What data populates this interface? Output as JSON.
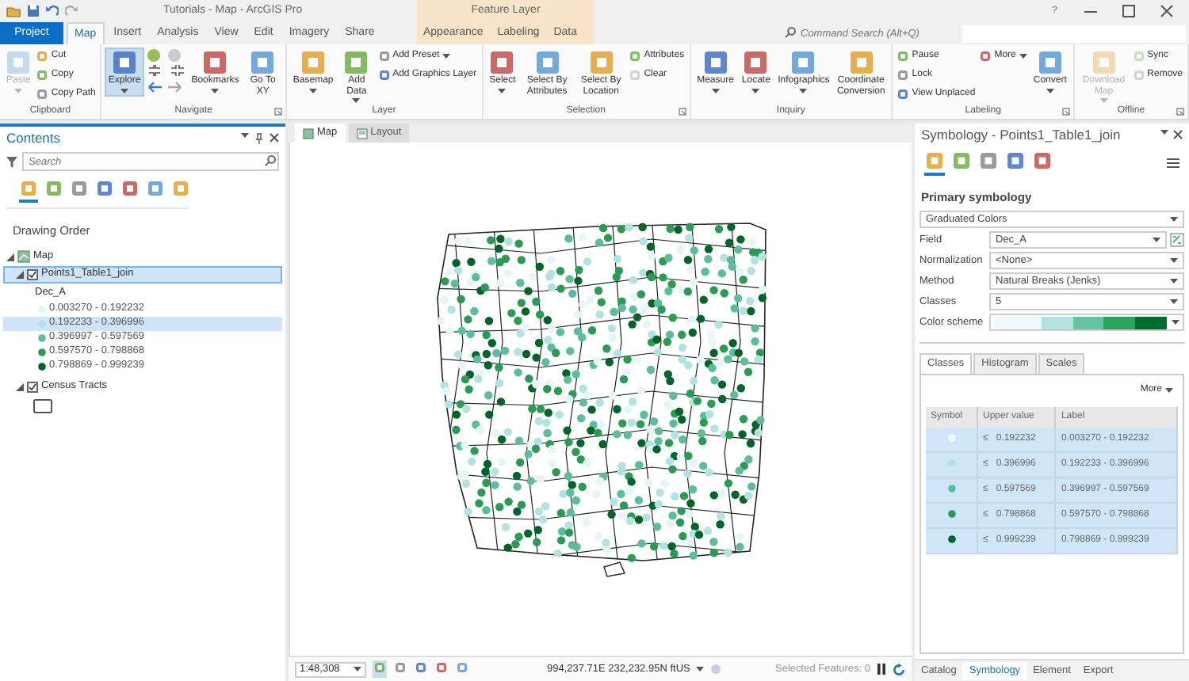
{
  "title_bar": {
    "title": "Tutorials - Map - ArcGIS Pro",
    "context_header": "Feature Layer",
    "help": "?"
  },
  "ribbon_tabs": [
    {
      "label": "Project",
      "kind": "backstage",
      "selected": false
    },
    {
      "label": "Map",
      "kind": "core",
      "selected": true
    },
    {
      "label": "Insert",
      "kind": "core",
      "selected": false
    },
    {
      "label": "Analysis",
      "kind": "core",
      "selected": false
    },
    {
      "label": "View",
      "kind": "core",
      "selected": false
    },
    {
      "label": "Edit",
      "kind": "core",
      "selected": false
    },
    {
      "label": "Imagery",
      "kind": "core",
      "selected": false
    },
    {
      "label": "Share",
      "kind": "core",
      "selected": false
    },
    {
      "label": "Appearance",
      "kind": "contextual",
      "selected": false
    },
    {
      "label": "Labeling",
      "kind": "contextual",
      "selected": false
    },
    {
      "label": "Data",
      "kind": "contextual",
      "selected": false
    }
  ],
  "command_search": {
    "placeholder": "Command Search (Alt+Q)"
  },
  "ribbon_groups": [
    {
      "label": "Clipboard",
      "launcher": false,
      "commands": [
        {
          "label": "Paste",
          "kind": "large",
          "menu": true,
          "disabled": true,
          "selected": false
        },
        {
          "label": "Cut",
          "kind": "small",
          "menu": false,
          "disabled": false,
          "selected": false
        },
        {
          "label": "Copy",
          "kind": "small",
          "menu": false,
          "disabled": false,
          "selected": false
        },
        {
          "label": "Copy Path",
          "kind": "small",
          "menu": false,
          "disabled": false,
          "selected": false
        }
      ]
    },
    {
      "label": "Navigate",
      "launcher": true,
      "commands": [
        {
          "label": "Explore",
          "kind": "large",
          "menu": true,
          "disabled": false,
          "selected": true
        },
        {
          "kind": "nav_grid",
          "menu": false,
          "disabled": false,
          "selected": false
        },
        {
          "label": "Bookmarks",
          "kind": "large",
          "menu": true,
          "disabled": false,
          "selected": false
        },
        {
          "label": "Go To XY",
          "kind": "large",
          "menu": false,
          "disabled": false,
          "selected": false
        }
      ]
    },
    {
      "label": "Layer",
      "launcher": false,
      "commands": [
        {
          "label": "Basemap",
          "kind": "large",
          "menu": true,
          "disabled": false,
          "selected": false
        },
        {
          "label": "Add Data",
          "kind": "large",
          "menu": true,
          "disabled": false,
          "selected": false
        },
        {
          "label": "Add Preset",
          "kind": "small",
          "menu": true,
          "disabled": false,
          "selected": false
        },
        {
          "label": "Add Graphics Layer",
          "kind": "small",
          "menu": false,
          "disabled": false,
          "selected": false
        }
      ]
    },
    {
      "label": "Selection",
      "launcher": true,
      "commands": [
        {
          "label": "Select",
          "kind": "large",
          "menu": true,
          "disabled": false,
          "selected": false
        },
        {
          "label": "Select By Attributes",
          "kind": "large",
          "menu": false,
          "disabled": false,
          "selected": false
        },
        {
          "label": "Select By Location",
          "kind": "large",
          "menu": false,
          "disabled": false,
          "selected": false
        },
        {
          "label": "Attributes",
          "kind": "small",
          "menu": false,
          "disabled": false,
          "selected": false
        },
        {
          "label": "Clear",
          "kind": "small",
          "menu": false,
          "disabled": true,
          "selected": false
        }
      ]
    },
    {
      "label": "Inquiry",
      "launcher": false,
      "commands": [
        {
          "label": "Measure",
          "kind": "large",
          "menu": true,
          "disabled": false,
          "selected": false
        },
        {
          "label": "Locate",
          "kind": "large",
          "menu": true,
          "disabled": false,
          "selected": false
        },
        {
          "label": "Infographics",
          "kind": "large",
          "menu": true,
          "disabled": false,
          "selected": false
        },
        {
          "label": "Coordinate Conversion",
          "kind": "large",
          "menu": false,
          "disabled": false,
          "selected": false
        }
      ]
    },
    {
      "label": "Labeling",
      "launcher": true,
      "commands": [
        {
          "label": "Pause",
          "kind": "small",
          "menu": false,
          "disabled": false,
          "selected": false
        },
        {
          "label": "Lock",
          "kind": "small",
          "menu": false,
          "disabled": false,
          "selected": false
        },
        {
          "label": "View Unplaced",
          "kind": "small",
          "menu": false,
          "disabled": false,
          "selected": false
        },
        {
          "label": "More",
          "kind": "small",
          "menu": true,
          "disabled": false,
          "selected": false
        },
        {
          "label": "Convert",
          "kind": "large",
          "menu": true,
          "disabled": false,
          "selected": false
        }
      ]
    },
    {
      "label": "Offline",
      "launcher": true,
      "commands": [
        {
          "label": "Download Map",
          "kind": "large",
          "menu": true,
          "disabled": true,
          "selected": false
        },
        {
          "label": "Sync",
          "kind": "small",
          "menu": false,
          "disabled": true,
          "selected": false
        },
        {
          "label": "Remove",
          "kind": "small",
          "menu": false,
          "disabled": true,
          "selected": false
        }
      ]
    }
  ],
  "contents": {
    "title": "Contents",
    "search": {
      "placeholder": "Search"
    },
    "view_tools": [
      {
        "selected": true
      },
      {
        "selected": false
      },
      {
        "selected": false
      },
      {
        "selected": false
      },
      {
        "selected": false
      },
      {
        "selected": false
      },
      {
        "selected": false
      }
    ],
    "heading": "Drawing Order",
    "tree": [
      {
        "label": "Map",
        "kind": "map",
        "expanded": true,
        "selected": false,
        "children": [
          {
            "label": "Points1_Table1_join",
            "kind": "points",
            "checked": true,
            "selected": true,
            "expanded": true,
            "legend_field": "Dec_A",
            "classes": [
              {
                "label": "0.003270 - 0.192232",
                "color": "#e6f5f5",
                "selected": false
              },
              {
                "label": "0.192233 - 0.396996",
                "color": "#b2e2e2",
                "selected": true
              },
              {
                "label": "0.396997 - 0.597569",
                "color": "#5cbc9b",
                "selected": false
              },
              {
                "label": "0.597570 - 0.798868",
                "color": "#2a9a55",
                "selected": false
              },
              {
                "label": "0.798869 - 0.999239",
                "color": "#00632a",
                "selected": false
              }
            ]
          },
          {
            "label": "Census Tracts",
            "kind": "polygons",
            "checked": true,
            "selected": false,
            "expanded": true
          }
        ]
      }
    ]
  },
  "map_view": {
    "tabs": [
      {
        "label": "Map",
        "kind": "map",
        "selected": true
      },
      {
        "label": "Layout",
        "kind": "layout",
        "selected": false
      }
    ],
    "scale": "1:48,308",
    "status_tools": [
      {
        "selected": true
      },
      {
        "selected": false
      },
      {
        "selected": false
      },
      {
        "selected": false
      },
      {
        "selected": false
      }
    ],
    "coordinates": "994,237.71E 232,232.95N ftUS",
    "selected_features": "Selected Features: 0"
  },
  "symbology": {
    "title": "Symbology - Points1_Table1_join",
    "tools": [
      {
        "selected": true
      },
      {
        "selected": false
      },
      {
        "selected": false
      },
      {
        "selected": false
      },
      {
        "selected": false
      }
    ],
    "section": "Primary symbology",
    "renderer": "Graduated Colors",
    "fields": [
      {
        "label": "Field",
        "kind": "expression",
        "value": "Dec_A"
      },
      {
        "label": "Normalization",
        "kind": "select",
        "value": "<None>"
      },
      {
        "label": "Method",
        "kind": "select",
        "value": "Natural Breaks (Jenks)"
      },
      {
        "label": "Classes",
        "kind": "select",
        "value": "5"
      },
      {
        "label": "Color scheme",
        "kind": "ramp",
        "ramp": [
          {
            "color": "#edf8fb"
          },
          {
            "color": "#b2e2e2"
          },
          {
            "color": "#66c2a4"
          },
          {
            "color": "#2ca25f"
          },
          {
            "color": "#006d2c"
          }
        ]
      }
    ],
    "tabs": [
      {
        "label": "Classes",
        "selected": true
      },
      {
        "label": "Histogram",
        "selected": false
      },
      {
        "label": "Scales",
        "selected": false
      }
    ],
    "more": "More",
    "columns": [
      "Symbol",
      "Upper value",
      "Label"
    ],
    "classes": [
      {
        "color": "#f4fbfb",
        "operator": "≤",
        "upper": "0.192232",
        "label": "0.003270 - 0.192232",
        "selected": true
      },
      {
        "color": "#b2e2e2",
        "operator": "≤",
        "upper": "0.396996",
        "label": "0.192233 - 0.396996",
        "selected": true
      },
      {
        "color": "#5cbc9b",
        "operator": "≤",
        "upper": "0.597569",
        "label": "0.396997 - 0.597569",
        "selected": true
      },
      {
        "color": "#2a9a55",
        "operator": "≤",
        "upper": "0.798868",
        "label": "0.597570 - 0.798868",
        "selected": true
      },
      {
        "color": "#00632a",
        "operator": "≤",
        "upper": "0.999239",
        "label": "0.798869 - 0.999239",
        "selected": true
      }
    ]
  },
  "dock_tabs": [
    {
      "label": "Catalog",
      "selected": false
    },
    {
      "label": "Symbology",
      "selected": true
    },
    {
      "label": "Element",
      "selected": false
    },
    {
      "label": "Export",
      "selected": false
    }
  ]
}
